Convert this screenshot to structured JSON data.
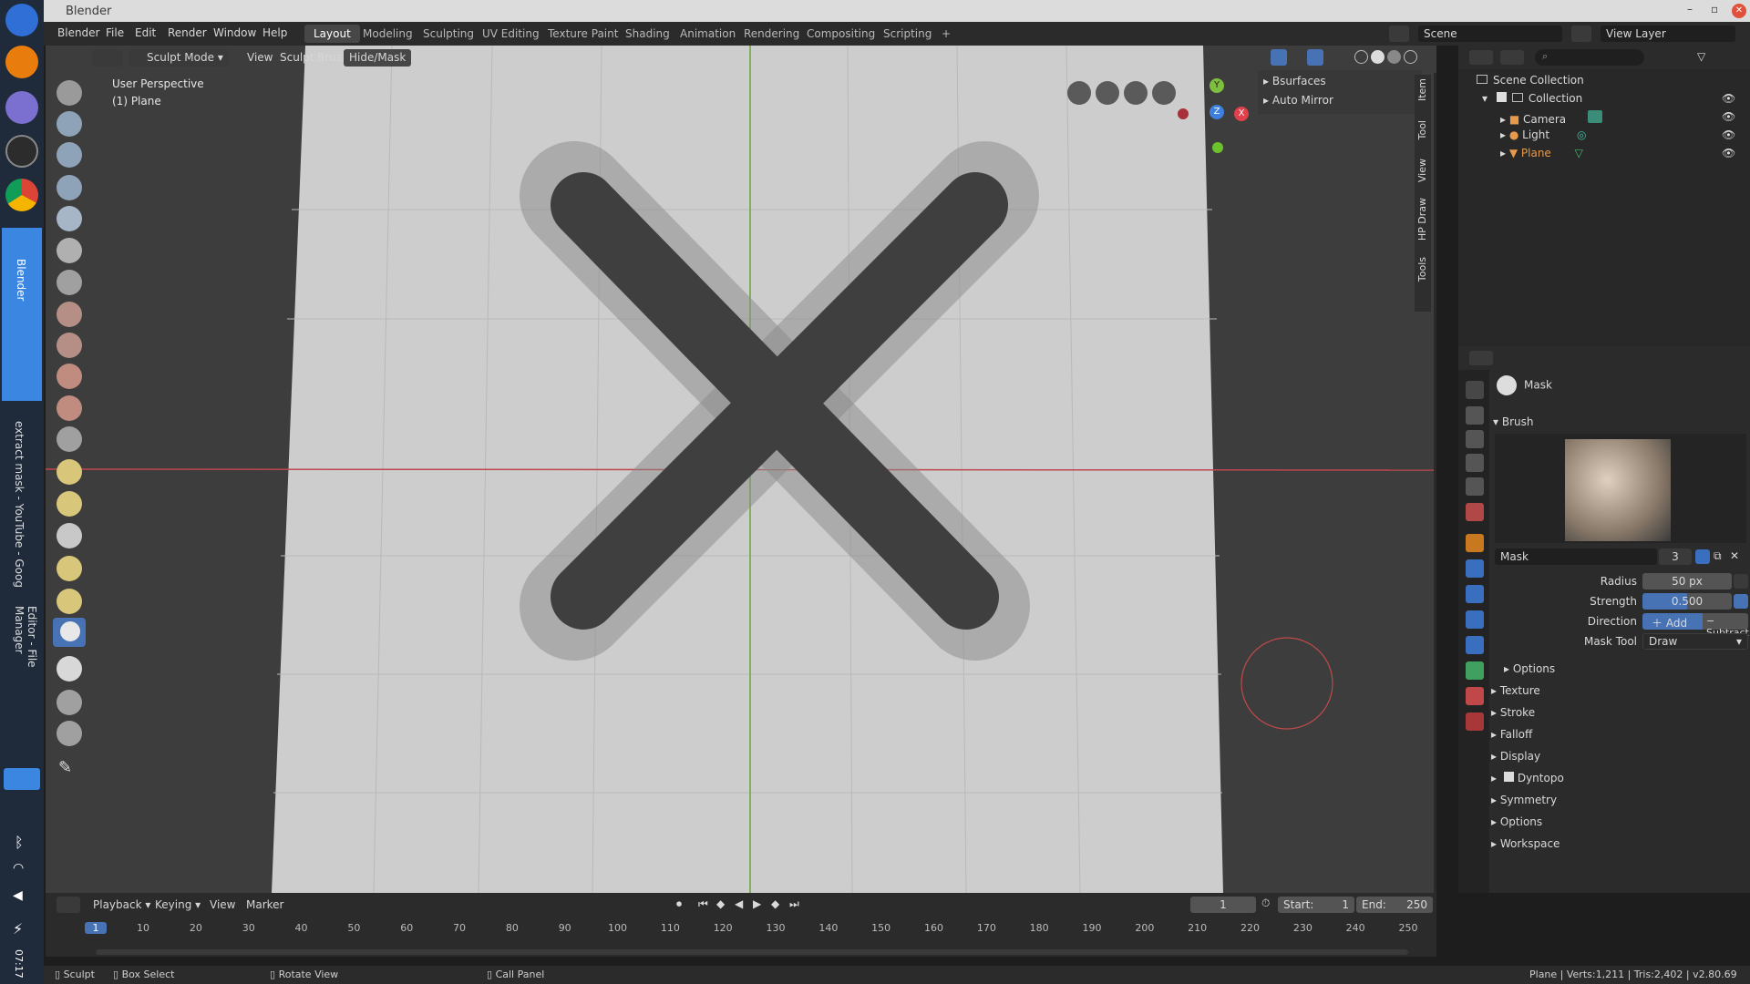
{
  "app": {
    "title": "Blender"
  },
  "dock": {
    "task_labels": [
      "Blender",
      "extract mask - YouTube - Goog",
      "Editor - File Manager"
    ],
    "clock": "07:17"
  },
  "menu": {
    "items": [
      "Blender",
      "File",
      "Edit",
      "Render",
      "Window",
      "Help"
    ]
  },
  "workspaces": [
    "Layout",
    "Modeling",
    "Sculpting",
    "UV Editing",
    "Texture Paint",
    "Shading",
    "Animation",
    "Rendering",
    "Compositing",
    "Scripting",
    "+"
  ],
  "scene": {
    "scene_name": "Scene",
    "view_layer": "View Layer"
  },
  "viewport": {
    "mode": "Sculpt Mode",
    "menus": [
      "View",
      "Sculpt",
      "Brush",
      "Hide/Mask"
    ],
    "overlay_line1": "User Perspective",
    "overlay_line2": "(1) Plane",
    "panel_items": [
      "Bsurfaces",
      "Auto Mirror"
    ],
    "side_tabs": [
      "Item",
      "Tool",
      "View",
      "HP Draw",
      "Tools"
    ],
    "gizmo": {
      "x": "X",
      "y": "Y",
      "z": "Z"
    }
  },
  "outliner": {
    "root": "Scene Collection",
    "collection": "Collection",
    "objects": [
      "Camera",
      "Light",
      "Plane"
    ]
  },
  "properties": {
    "brush_header": "Mask",
    "brush_section": "Brush",
    "brush_name": "Mask",
    "brush_users": "3",
    "radius_label": "Radius",
    "radius_value": "50 px",
    "strength_label": "Strength",
    "strength_value": "0.500",
    "strength_fraction": 0.5,
    "direction_label": "Direction",
    "direction_add": "Add",
    "direction_subtract": "Subtract",
    "mask_tool_label": "Mask Tool",
    "mask_tool_value": "Draw",
    "options_sub": "Options",
    "sections": [
      "Texture",
      "Stroke",
      "Falloff",
      "Display",
      "Dyntopo",
      "Symmetry",
      "Options",
      "Workspace"
    ]
  },
  "timeline": {
    "menus": [
      "Playback",
      "Keying",
      "View",
      "Marker"
    ],
    "current_frame": "1",
    "start_label": "Start:",
    "start": "1",
    "end_label": "End:",
    "end": "250",
    "ticks": [
      "1",
      "10",
      "20",
      "30",
      "40",
      "50",
      "60",
      "70",
      "80",
      "90",
      "100",
      "110",
      "120",
      "130",
      "140",
      "150",
      "160",
      "170",
      "180",
      "190",
      "200",
      "210",
      "220",
      "230",
      "240",
      "250"
    ]
  },
  "status": {
    "left_items": [
      "Sculpt",
      "Box Select",
      "Rotate View",
      "Call Panel"
    ],
    "right": "Plane | Verts:1,211 | Tris:2,402 | v2.80.69"
  },
  "colors": {
    "accent": "#4772b3",
    "active_obj": "#e79a4b",
    "x_axis": "#e0404a",
    "y_axis": "#7fbf3f",
    "z_axis": "#3f7fdf"
  }
}
